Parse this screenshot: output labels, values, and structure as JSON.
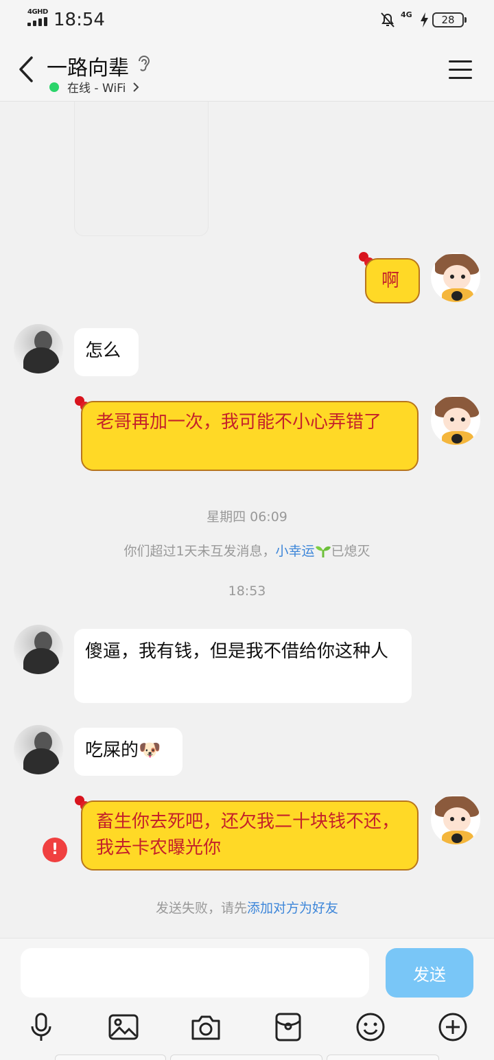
{
  "status_bar": {
    "network": "4GHD",
    "time": "18:54",
    "mobile_data": "4G",
    "battery": "28"
  },
  "header": {
    "title": "一路向辈",
    "status": "在线 - WiFi"
  },
  "messages": [
    {
      "side": "right",
      "text": "啊"
    },
    {
      "side": "left",
      "text": "怎么"
    },
    {
      "side": "right",
      "text": "老哥再加一次，我可能不小心弄错了"
    },
    {
      "side": "left",
      "text": "傻逼，我有钱，但是我不借给你这种人"
    },
    {
      "side": "left",
      "text": "吃屎的🐶"
    },
    {
      "side": "right",
      "text": "畜生你去死吧，还欠我二十块钱不还，我去卡农曝光你",
      "failed": true
    }
  ],
  "timestamps": [
    "星期四 06:09",
    "18:53"
  ],
  "notice": {
    "prefix": "你们超过1天未互发消息，",
    "link": "小幸运",
    "suffix": "已熄灭"
  },
  "fail_notice": {
    "prefix": "发送失败，请先",
    "link": "添加对方为好友"
  },
  "input": {
    "placeholder": "",
    "send_label": "发送"
  },
  "colors": {
    "accent": "#3d86d9",
    "send_button": "#79c6f7",
    "bubble_yellow": "#ffd926",
    "bubble_text_red": "#c4212a",
    "online": "#2bd46a",
    "error": "#f04040"
  }
}
